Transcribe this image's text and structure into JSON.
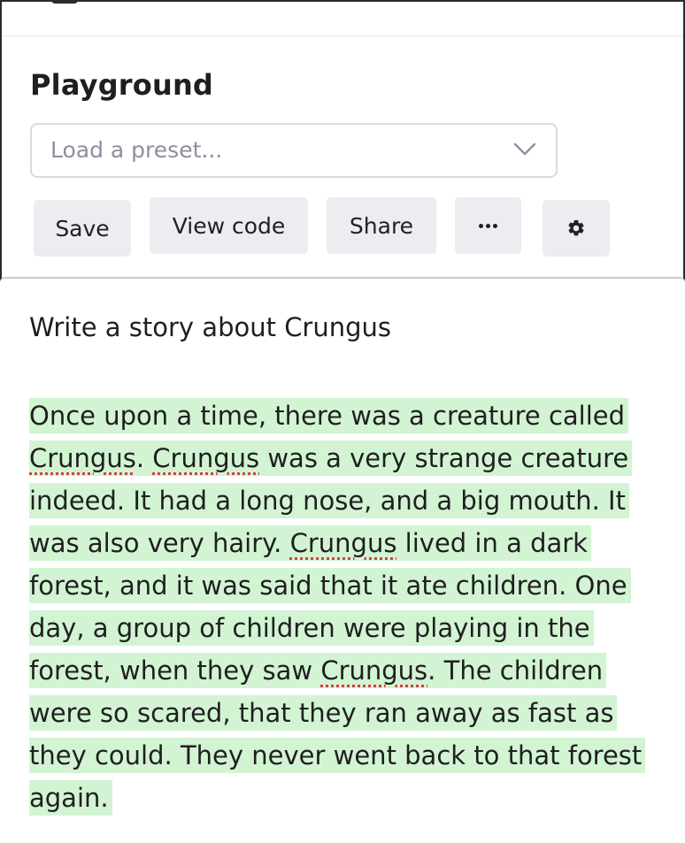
{
  "header": {
    "title": "Playground",
    "preset_placeholder": "Load a preset..."
  },
  "toolbar": {
    "save_label": "Save",
    "view_code_label": "View code",
    "share_label": "Share",
    "more_icon": "ellipsis-icon",
    "settings_icon": "gear-icon"
  },
  "editor": {
    "prompt": "Write a story about Crungus",
    "completion_lines": [
      {
        "before": "Once upon a time, there was a creature called",
        "word": "",
        "after": ""
      },
      {
        "before": "",
        "word": "Crungus",
        "mid": ". ",
        "word2": "Crungus",
        "after": " was a very strange creature"
      },
      {
        "before": "indeed. It had a long nose, and a big mouth. It",
        "word": "",
        "after": ""
      },
      {
        "before": "was also very hairy. ",
        "word": "Crungus",
        "after": " lived in a dark"
      },
      {
        "before": "forest, and it was said that it ate children. One",
        "word": "",
        "after": ""
      },
      {
        "before": "day, a group of children were playing in the",
        "word": "",
        "after": ""
      },
      {
        "before": "forest, when they saw ",
        "word": "Crungus",
        "after": ". The children"
      },
      {
        "before": "were so scared, that they ran away as fast as",
        "word": "",
        "after": ""
      },
      {
        "before": "they could. They never went back to that forest",
        "word": "",
        "after": ""
      },
      {
        "before": "again.",
        "word": "",
        "after": ""
      }
    ]
  },
  "colors": {
    "highlight": "#d2f4d3",
    "button_bg": "#ececf1",
    "spellcheck": "#d93d3d"
  }
}
